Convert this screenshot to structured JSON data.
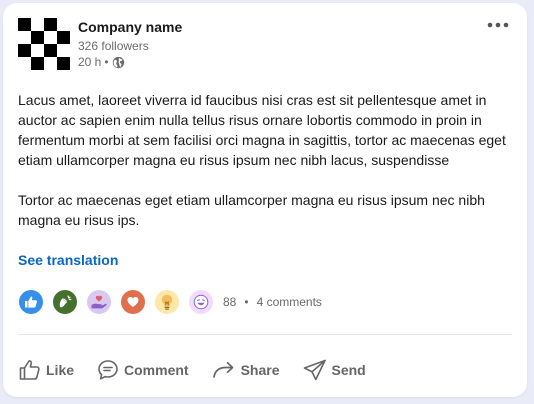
{
  "post": {
    "company_name": "Company name",
    "followers": "326 followers",
    "time": "20 h",
    "separator": "•",
    "paragraph_1": "Lacus amet, laoreet viverra id faucibus nisi cras est sit pellentesque amet in auctor ac sapien enim nulla tellus risus ornare lobortis commodo in proin in fermentum morbi at sem facilisi orci magna in sagittis, tortor ac maecenas eget etiam ullamcorper magna eu risus ipsum nec nibh lacus, suspendisse",
    "paragraph_2": "Tortor ac maecenas eget etiam ullamcorper magna eu risus ipsum nec nibh magna eu risus ips.",
    "see_translation": "See translation"
  },
  "social": {
    "reactions": [
      "like-icon",
      "celebrate-icon",
      "support-icon",
      "love-icon",
      "insightful-icon",
      "funny-icon"
    ],
    "reaction_count": "88",
    "separator": "•",
    "comments": "4 comments"
  },
  "actions": {
    "like": "Like",
    "comment": "Comment",
    "share": "Share",
    "send": "Send"
  },
  "colors": {
    "link": "#0a66c2",
    "like": "#378fe9",
    "celebrate": "#44712e",
    "support": "#a872e8",
    "love": "#df704d",
    "insightful": "#f5bb5c",
    "funny": "#e7a3ff"
  }
}
